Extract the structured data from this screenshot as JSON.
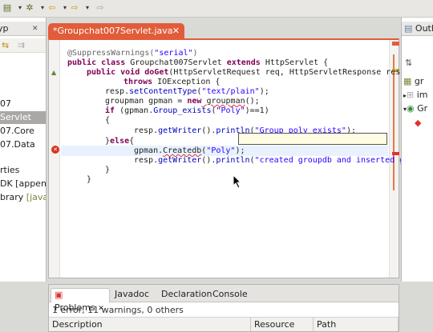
{
  "toolbar": {
    "icons": [
      "run-icon",
      "dropdown-icon",
      "debug-icon",
      "dropdown-icon",
      "back-icon",
      "dropdown-icon",
      "forward-icon",
      "dropdown-icon"
    ]
  },
  "left_panel": {
    "tab_label": "yp",
    "items": [
      {
        "label": "07",
        "selected": false
      },
      {
        "label": "Servlet",
        "selected": true
      },
      {
        "label": "07.Core",
        "selected": false
      },
      {
        "label": "07.Data",
        "selected": false
      },
      {
        "label": "rties",
        "selected": false
      },
      {
        "label": "DK [appengi",
        "selected": false
      },
      {
        "label": "brary",
        "suffix": "[java-",
        "selected": false
      }
    ]
  },
  "editor": {
    "tab_title": "*Groupchat007Servlet.java",
    "close_glyph": "✕",
    "lines": [
      {
        "annotation": "@SuppressWarnings(",
        "string": "\"serial\"",
        "tail": ")"
      },
      {
        "kw1": "public class",
        "text1": " Groupchat007Servlet ",
        "kw2": "extends",
        "text2": " HttpServlet {"
      },
      {
        "kw1": "public void",
        "method": " doGet",
        "text": "(HttpServletRequest req, HttpServletResponse resp"
      },
      {
        "kw1": "throws",
        "text": " IOException {"
      },
      {
        "text": "resp.",
        "method": "setContentType",
        "string": "\"text/plain\"",
        "tail": ");"
      },
      {
        "text": "groupman gpman = ",
        "kw": "new",
        "err": " groupman",
        "tail": "();"
      },
      {
        "kw": "if",
        "text": " (gpman.",
        "method": "Group_exists",
        "string": "\"Poly\"",
        "tail": ")==1)"
      },
      {
        "text": "{"
      },
      {
        "text": "resp.",
        "method": "getWriter",
        "mid": "().",
        "method2": "println",
        "string": "\"Group poly exists\"",
        "tail": ");"
      },
      {
        "text": "}",
        "kw": "else",
        "tail": "{"
      },
      {
        "text": "gpman.",
        "err": "Createdb",
        "string": "\"Poly\"",
        "tail": ");"
      },
      {
        "text": "resp.",
        "method": "getWriter",
        "mid": "().",
        "method2": "println",
        "string": "\"created groupdb and inserted gb"
      },
      {
        "text": "}"
      },
      {
        "text": "}"
      }
    ]
  },
  "right_panel": {
    "tab_label": "Outl",
    "items": [
      "gr",
      "im",
      "Gr",
      ""
    ]
  },
  "bottom": {
    "tabs": [
      {
        "label": "Problems",
        "active": true,
        "close": "✕"
      },
      {
        "label": "Javadoc",
        "active": false
      },
      {
        "label": "Declaration",
        "active": false
      },
      {
        "label": "Console",
        "active": false
      }
    ],
    "summary": "1 error, 11 warnings, 0 others",
    "columns": [
      "Description",
      "Resource",
      "Path"
    ]
  }
}
